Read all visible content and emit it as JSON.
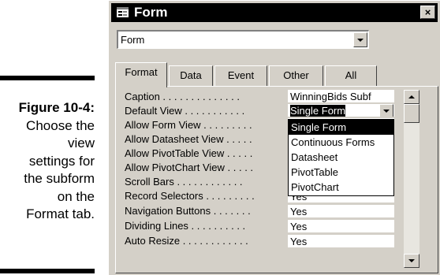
{
  "caption": {
    "figure": "Figure 10-4:",
    "lines": [
      "Choose the",
      "view",
      "settings for",
      "the subform",
      "on the",
      "Format tab."
    ]
  },
  "window": {
    "title": "Form",
    "close_label": "×"
  },
  "object_selector": {
    "value": "Form"
  },
  "tabs": [
    {
      "label": "Format",
      "active": true
    },
    {
      "label": "Data",
      "active": false
    },
    {
      "label": "Event",
      "active": false
    },
    {
      "label": "Other",
      "active": false
    },
    {
      "label": "All",
      "active": false
    }
  ],
  "properties": [
    {
      "label": "Caption . . . . . . . . . . . . . .",
      "value": "WinningBids Subf"
    },
    {
      "label": "Default View . . . . . . . . . . .",
      "value": "Single Form"
    },
    {
      "label": "Allow Form View . . . . . . . . .",
      "value": ""
    },
    {
      "label": "Allow Datasheet View . . . . .",
      "value": ""
    },
    {
      "label": "Allow PivotTable View . . . . .",
      "value": ""
    },
    {
      "label": "Allow PivotChart View . . . . .",
      "value": ""
    },
    {
      "label": "Scroll Bars . . . . . . . . . . . .",
      "value": ""
    },
    {
      "label": "Record Selectors . . . . . . . . .",
      "value": "Yes"
    },
    {
      "label": "Navigation Buttons . . . . . . .",
      "value": "Yes"
    },
    {
      "label": "Dividing Lines . . . . . . . . . .",
      "value": "Yes"
    },
    {
      "label": "Auto Resize . . . . . . . . . . . .",
      "value": "Yes"
    }
  ],
  "default_view_options": [
    "Single Form",
    "Continuous Forms",
    "Datasheet",
    "PivotTable",
    "PivotChart"
  ],
  "colors": {
    "titlebar": "#000000",
    "window": "#d4d0c8",
    "highlight": "#000000"
  },
  "icons": {
    "title": "form-icon",
    "close": "close-icon",
    "dropdown": "chevron-down-icon",
    "scroll_up": "scroll-up-arrow-icon",
    "scroll_down": "scroll-down-arrow-icon"
  }
}
